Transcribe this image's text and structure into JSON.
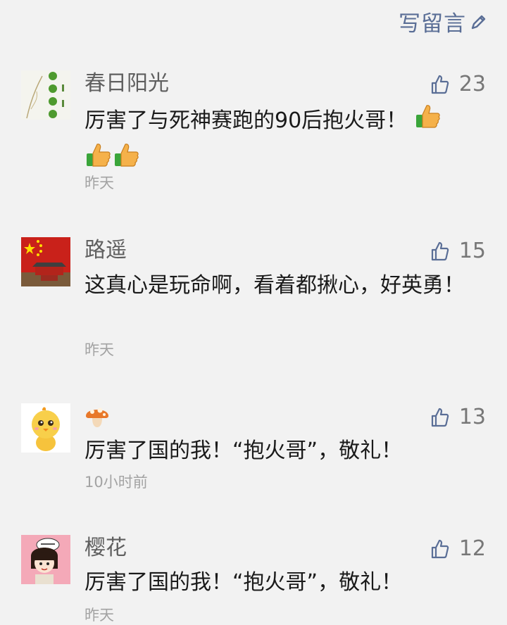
{
  "header": {
    "write_label": "写留言"
  },
  "comments": [
    {
      "nickname": "春日阳光",
      "likes": "23",
      "content": "厉害了与死神赛跑的90后抱火哥！",
      "time": "昨天"
    },
    {
      "nickname": "路遥",
      "likes": "15",
      "content": "这真心是玩命啊，看着都揪心，好英勇！",
      "time": "昨天"
    },
    {
      "nickname": "",
      "likes": "13",
      "content": "厉害了国的我！“抱火哥”，敬礼！",
      "time": "10小时前"
    },
    {
      "nickname": "樱花",
      "likes": "12",
      "content": "厉害了国的我！“抱火哥”，敬礼！",
      "time": "昨天"
    }
  ]
}
